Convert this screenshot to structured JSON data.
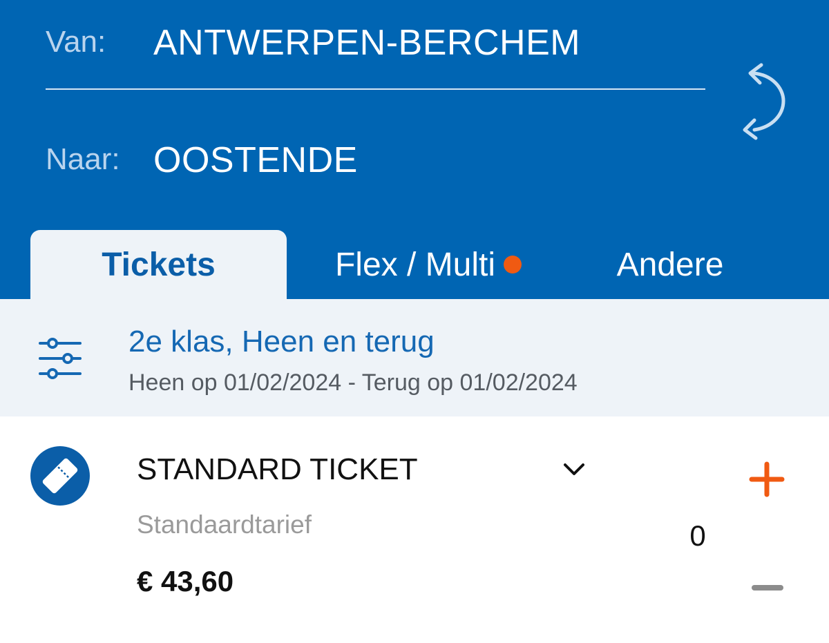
{
  "route": {
    "from_label": "Van:",
    "from_value": "ANTWERPEN-BERCHEM",
    "to_label": "Naar:",
    "to_value": "OOSTENDE",
    "swap_icon": "swap-arrows-icon"
  },
  "tabs": [
    {
      "label": "Tickets",
      "active": true
    },
    {
      "label": "Flex / Multi",
      "active": false,
      "badge_color": "#f05a12"
    },
    {
      "label": "Andere",
      "active": false
    }
  ],
  "filter": {
    "icon": "sliders-icon",
    "title": "2e klas, Heen en terug",
    "subtitle": "Heen op 01/02/2024 - Terug op 01/02/2024"
  },
  "ticket": {
    "icon": "ticket-icon",
    "name": "STANDARD TICKET",
    "tariff": "Standaardtarief",
    "price": "€ 43,60",
    "quantity": "0",
    "plus_icon": "plus-icon",
    "minus_icon": "minus-icon"
  },
  "colors": {
    "brand_blue": "#0065b3",
    "accent_orange": "#f05a12",
    "filter_bg": "#eef3f8"
  }
}
